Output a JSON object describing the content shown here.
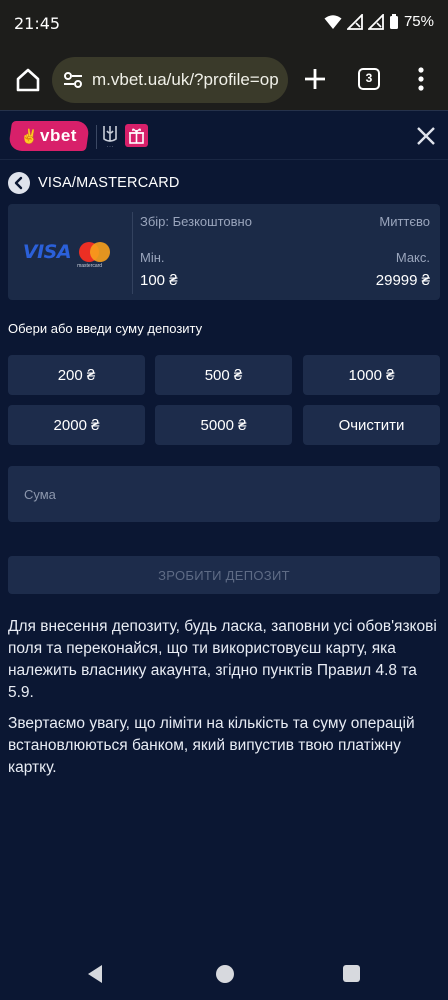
{
  "status_bar": {
    "time": "21:45",
    "battery": "75%"
  },
  "browser": {
    "url": "m.vbet.ua/uk/?profile=op",
    "tab_count": "3"
  },
  "header": {
    "logo_text": "vbet"
  },
  "method": {
    "title": "VISA/MASTERCARD"
  },
  "card_info": {
    "visa_label": "VISA",
    "mastercard_caption": "mastercard",
    "fee": "Збір: Безкоштовно",
    "speed": "Миттєво",
    "min_label": "Мін.",
    "max_label": "Макс.",
    "min_value": "100 ₴",
    "max_value": "29999 ₴"
  },
  "deposit_form": {
    "prompt": "Обери або введи суму депозиту",
    "amounts": [
      "200 ₴",
      "500 ₴",
      "1000 ₴",
      "2000 ₴",
      "5000 ₴"
    ],
    "clear_label": "Очистити",
    "sum_placeholder": "Сума",
    "submit_label": "ЗРОБИТИ ДЕПОЗИТ"
  },
  "info": {
    "paragraph_1": "Для внесення депозиту, будь ласка, заповни усі обов'язкові поля та переконайся, що ти використовуєш карту, яка належить власнику акаунта, згідно пунктів Правил 4.8 та 5.9.",
    "paragraph_2": "Звертаємо увагу, що ліміти на кількість та суму операцій встановлюються банком, який випустив твою платіжну картку."
  },
  "colors": {
    "accent": "#d8206a",
    "background": "#0b1733",
    "panel": "#1d2c4b"
  }
}
